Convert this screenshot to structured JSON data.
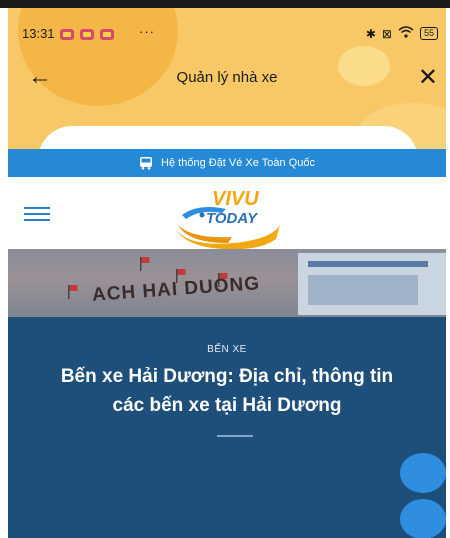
{
  "status_bar": {
    "time": "13:31",
    "more": "···",
    "battery": "55"
  },
  "header": {
    "title": "Quản lý nhà xe"
  },
  "notice": {
    "text": "Hệ thống Đặt Vé Xe Toàn Quốc"
  },
  "logo": {
    "line1": "VIVU",
    "line2": "TODAY"
  },
  "hero": {
    "photo_sign": "ACH HAI DUONG",
    "category": "BẾN XE",
    "headline_line1": "Bến xe Hải Dương: Địa chỉ, thông tin",
    "headline_line2": "các bến xe tại Hải Dương"
  },
  "colors": {
    "header_bg": "#f8c867",
    "accent_blue": "#2589d6",
    "hero_bg": "#1e4f7b"
  }
}
